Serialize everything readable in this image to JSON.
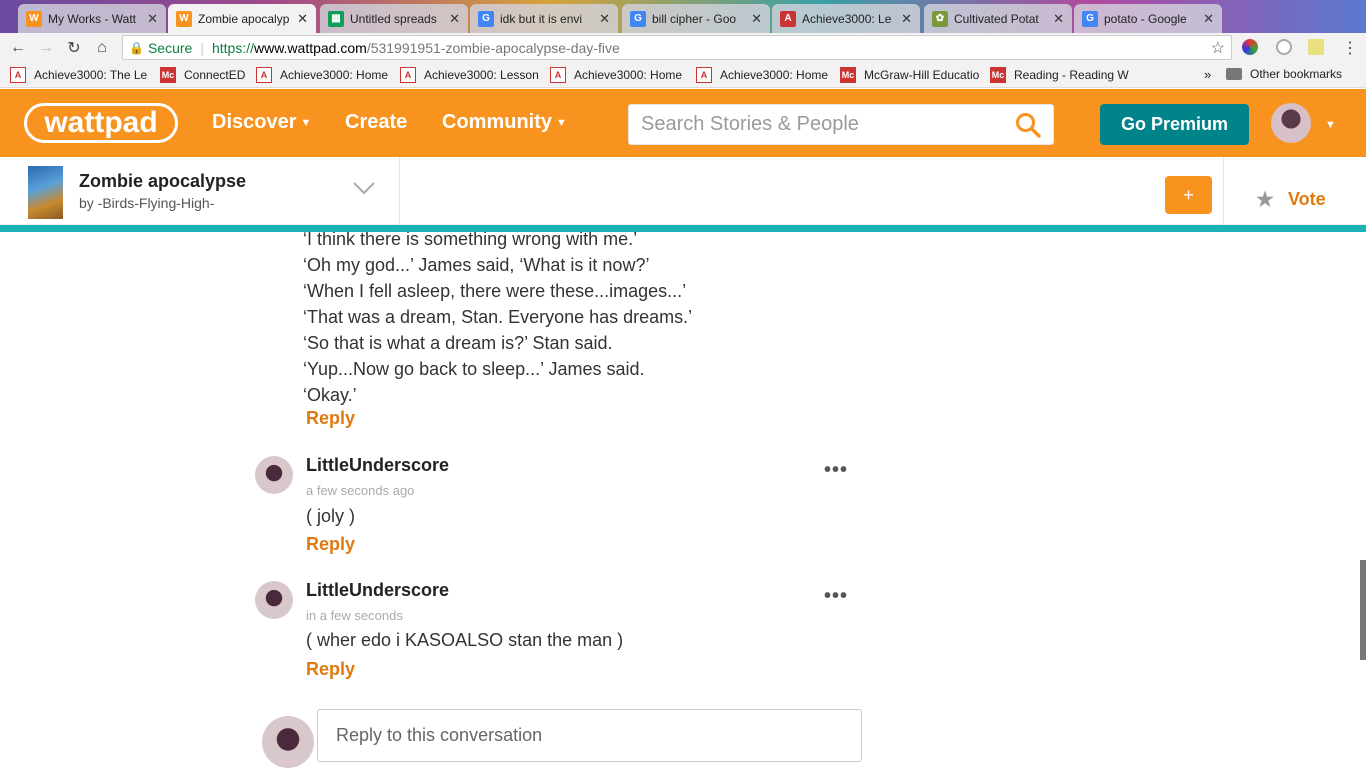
{
  "browser": {
    "tabs": [
      {
        "title": "My Works - Watt",
        "icon": "W",
        "color": "#f7931e"
      },
      {
        "title": "Zombie apocalyp",
        "icon": "W",
        "color": "#f7931e",
        "active": true
      },
      {
        "title": "Untitled spreads",
        "icon": "▦",
        "color": "#0f9d58"
      },
      {
        "title": "idk but it is envi",
        "icon": "G",
        "color": "#4285f4"
      },
      {
        "title": "bill cipher - Goo",
        "icon": "G",
        "color": "#4285f4"
      },
      {
        "title": "Achieve3000: Le",
        "icon": "A",
        "color": "#c33"
      },
      {
        "title": "Cultivated Potat",
        "icon": "✿",
        "color": "#7a9a3a"
      },
      {
        "title": "potato - Google",
        "icon": "G",
        "color": "#4285f4"
      }
    ],
    "secure_label": "Secure",
    "url_scheme": "https://",
    "url_host": "www.wattpad.com",
    "url_path": "/531991951-zombie-apocalypse-day-five",
    "bookmarks": [
      {
        "label": "Achieve3000: The Le",
        "icon": "A"
      },
      {
        "label": "ConnectED",
        "icon": "Mc",
        "mh": true
      },
      {
        "label": "Achieve3000: Home",
        "icon": "A"
      },
      {
        "label": "Achieve3000: Lesson",
        "icon": "A"
      },
      {
        "label": "Achieve3000: Home",
        "icon": "A"
      },
      {
        "label": "Achieve3000: Home",
        "icon": "A"
      },
      {
        "label": "McGraw-Hill Educatio",
        "icon": "Mc",
        "mh": true
      },
      {
        "label": "Reading - Reading W",
        "icon": "Mc",
        "mh": true
      }
    ],
    "bookmarks_more": "»",
    "other_bookmarks": "Other bookmarks"
  },
  "header": {
    "logo": "wattpad",
    "nav": {
      "discover": "Discover",
      "create": "Create",
      "community": "Community"
    },
    "search_placeholder": "Search Stories & People",
    "premium": "Go Premium"
  },
  "story": {
    "title": "Zombie apocalypse",
    "author": "by -Birds-Flying-High-",
    "add": "+",
    "vote": "Vote"
  },
  "content": {
    "lines": [
      "‘I think there is something wrong with me.’",
      "‘Oh my god...’ James said, ‘What is it now?’",
      "‘When I fell asleep, there were these...images...’",
      "‘That was a dream, Stan. Everyone has dreams.’",
      "‘So that is what a dream is?’ Stan said.",
      "‘Yup...Now go back to sleep...’ James said.",
      "‘Okay.’"
    ],
    "reply_label": "Reply",
    "comments": [
      {
        "user": "LittleUnderscore",
        "time": "a few seconds ago",
        "text": "( joly )"
      },
      {
        "user": "LittleUnderscore",
        "time": "in a few seconds",
        "text": "( wher edo i KASOALSO stan the man )"
      }
    ],
    "more": "•••",
    "reply_placeholder": "Reply to this conversation"
  }
}
